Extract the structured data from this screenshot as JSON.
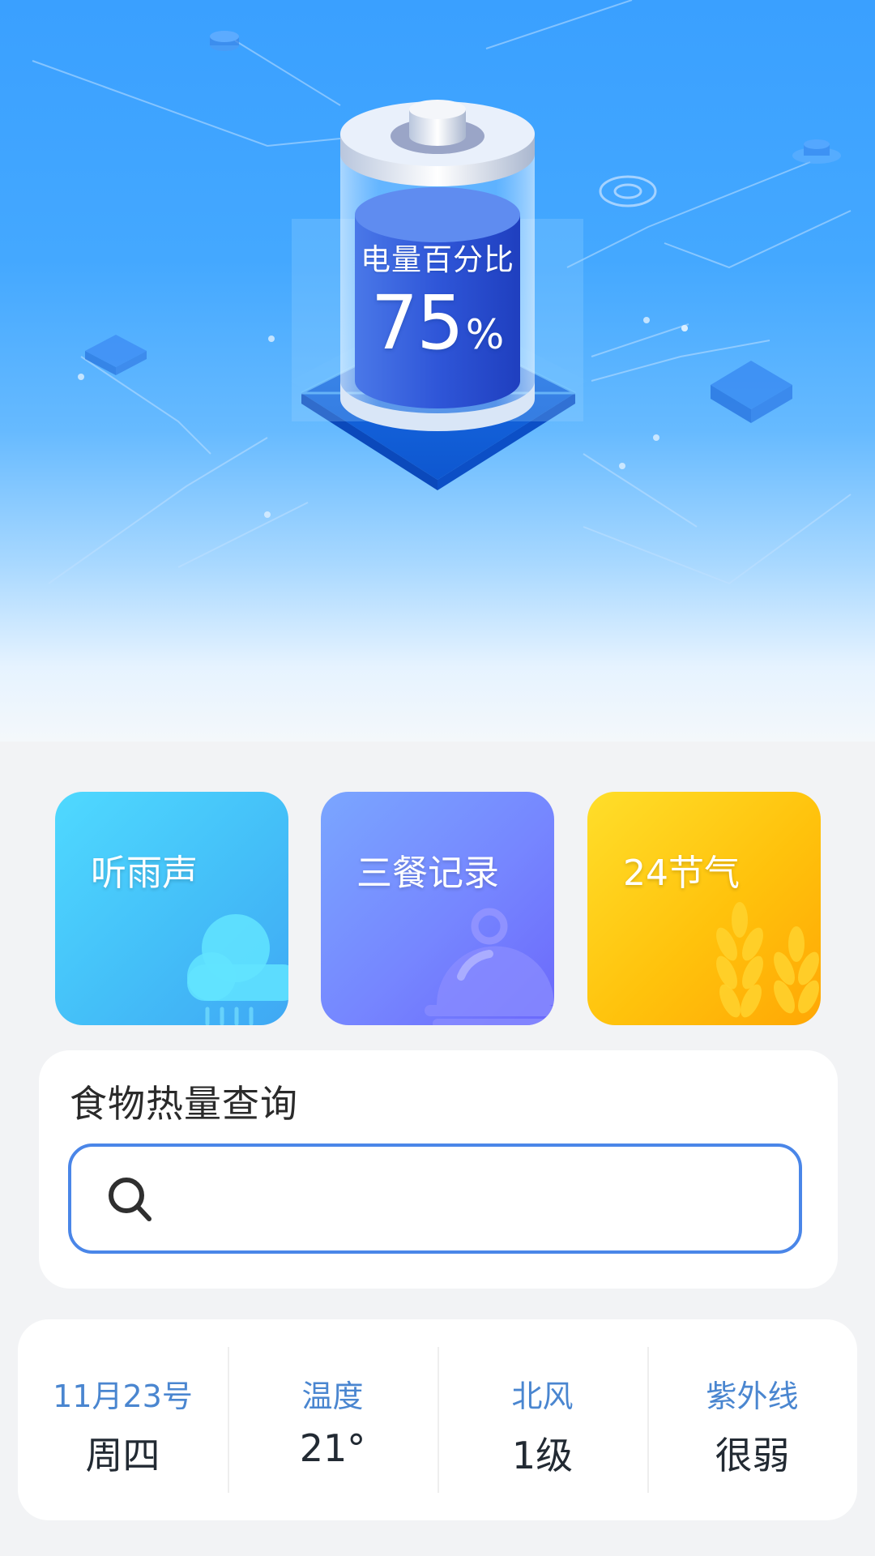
{
  "hero": {
    "battery_label": "电量百分比",
    "battery_value": "75",
    "battery_unit": "%"
  },
  "cards": [
    {
      "label": "听雨声",
      "icon": "cloud-rain-icon"
    },
    {
      "label": "三餐记录",
      "icon": "food-cloche-icon"
    },
    {
      "label": "24节气",
      "icon": "wheat-icon"
    }
  ],
  "search": {
    "title": "食物热量查询",
    "placeholder": "",
    "value": ""
  },
  "weather": [
    {
      "label": "11月23号",
      "value": "周四"
    },
    {
      "label": "温度",
      "value": "21°"
    },
    {
      "label": "北风",
      "value": "1级"
    },
    {
      "label": "紫外线",
      "value": "很弱"
    }
  ],
  "colors": {
    "accent_blue": "#4a86e8",
    "weather_label": "#4a86d0",
    "card_rain": "#44bff8",
    "card_meal": "#7686ff",
    "card_solar": "#ffc20c"
  }
}
